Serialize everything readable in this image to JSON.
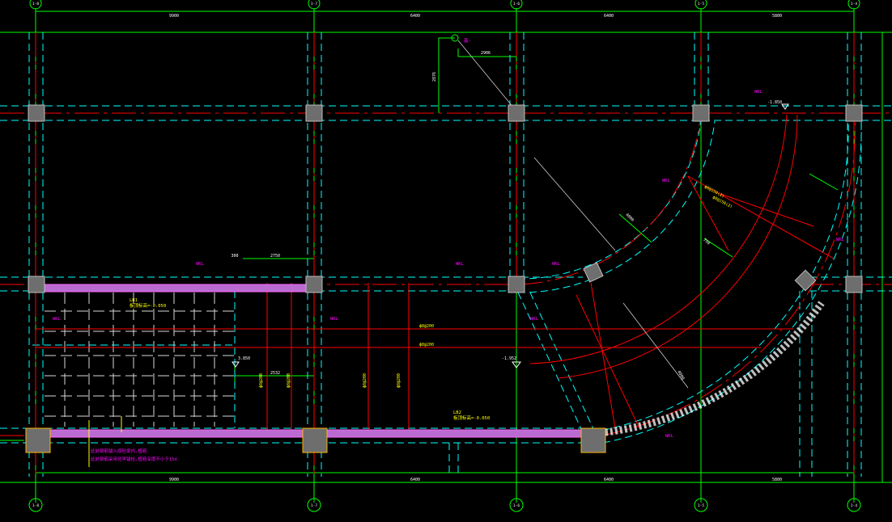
{
  "colors": {
    "background": "#000000",
    "grid": "#00ff00",
    "beam_outline": "#00ffff",
    "axis": "#ff0000",
    "text_magenta": "#ff00ff",
    "text_yellow": "#ffff00",
    "column_fill": "#6e6e6e",
    "slab_band": "#b96bd0",
    "leader": "#cfcfcf"
  },
  "grid_bubbles": {
    "top": [
      "1-8",
      "1-7",
      "1-6",
      "1-5",
      "1-4"
    ],
    "bottom": [
      "1-8",
      "1-7",
      "1-6",
      "1-5",
      "1-4"
    ]
  },
  "dimensions": {
    "top": [
      "9900",
      "6400",
      "6400",
      "5800"
    ],
    "bottom": [
      "9900",
      "6400",
      "6400",
      "5800"
    ],
    "misc": [
      "2906",
      "2876",
      "300",
      "2750",
      "2532",
      "4000",
      "750",
      "4000"
    ]
  },
  "beam_tags": [
    "WKL",
    "WKL",
    "WKL",
    "WKL",
    "WKL",
    "WKL",
    "WKL",
    "WKL",
    "WKL",
    "WKL"
  ],
  "level_marks": [
    "3.850",
    "-1.952",
    "-1.850"
  ],
  "rebar_notes": [
    "ф8@150(2)",
    "ф8@150(2)",
    "ф8@200",
    "ф8@200",
    "ф8@200",
    "ф8@200",
    "ф8@200",
    "ф8@200"
  ],
  "slab_notes": [
    "LB1\n板顶标高=-0.050",
    "LB2\n板顶标高=-0.050"
  ],
  "general_note": [
    "此处钢筋锚入原砼梁内,植筋",
    "此处钢筋采用化学锚栓,植筋深度不小于15d"
  ],
  "origin_mark": "基-"
}
